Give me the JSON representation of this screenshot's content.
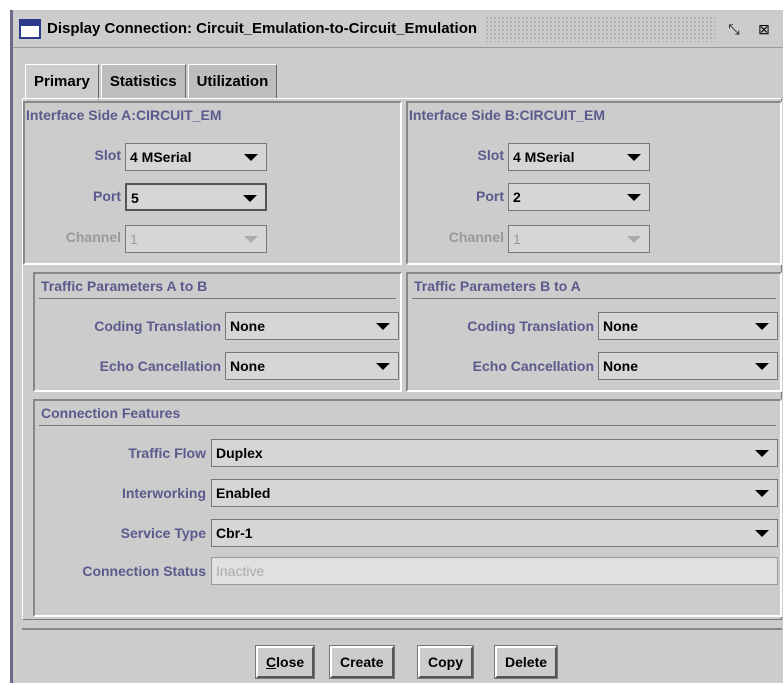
{
  "window": {
    "title": "Display Connection: Circuit_Emulation-to-Circuit_Emulation",
    "restore_icon": "restore-icon",
    "close_icon": "close-icon"
  },
  "tabs": [
    {
      "label": "Primary",
      "active": true
    },
    {
      "label": "Statistics",
      "active": false
    },
    {
      "label": "Utilization",
      "active": false
    }
  ],
  "side_a": {
    "title": "Interface Side A:CIRCUIT_EM",
    "slot_label": "Slot",
    "slot_value": "4 MSerial",
    "port_label": "Port",
    "port_value": "5",
    "channel_label": "Channel",
    "channel_value": "1"
  },
  "side_b": {
    "title": "Interface Side B:CIRCUIT_EM",
    "slot_label": "Slot",
    "slot_value": "4 MSerial",
    "port_label": "Port",
    "port_value": "2",
    "channel_label": "Channel",
    "channel_value": "1"
  },
  "traffic_ab": {
    "title": "Traffic Parameters A to B",
    "coding_label": "Coding Translation",
    "coding_value": "None",
    "echo_label": "Echo Cancellation",
    "echo_value": "None"
  },
  "traffic_ba": {
    "title": "Traffic Parameters B to A",
    "coding_label": "Coding Translation",
    "coding_value": "None",
    "echo_label": "Echo Cancellation",
    "echo_value": "None"
  },
  "features": {
    "title": "Connection Features",
    "traffic_flow_label": "Traffic Flow",
    "traffic_flow_value": "Duplex",
    "interworking_label": "Interworking",
    "interworking_value": "Enabled",
    "service_type_label": "Service Type",
    "service_type_value": "Cbr-1",
    "status_label": "Connection Status",
    "status_value": "Inactive"
  },
  "buttons": {
    "close_rest": "lose",
    "close_mnemonic": "C",
    "create": "Create",
    "copy": "Copy",
    "delete": "Delete"
  }
}
